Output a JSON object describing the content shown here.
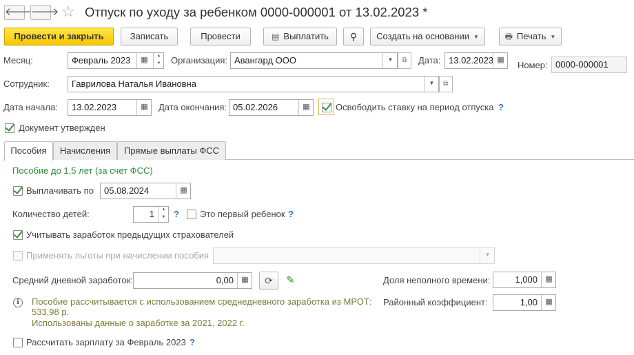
{
  "window": {
    "title": "Отпуск по уходу за ребенком 0000-000001 от 13.02.2023 *",
    "back_glyph": "🡐",
    "forward_glyph": "🡒",
    "star_glyph": "☆"
  },
  "toolbar": {
    "post_close": "Провести и закрыть",
    "save": "Записать",
    "post": "Провести",
    "pay": "Выплатить",
    "create_based": "Создать на основании",
    "print": "Печать"
  },
  "header": {
    "month_label": "Месяц:",
    "month_value": "Февраль 2023",
    "org_label": "Организация:",
    "org_value": "Авангард ООО",
    "date_label": "Дата:",
    "date_value": "13.02.2023",
    "number_label": "Номер:",
    "number_value": "0000-000001",
    "employee_label": "Сотрудник:",
    "employee_value": "Гаврилова Наталья Ивановна",
    "start_label": "Дата начала:",
    "start_value": "13.02.2023",
    "end_label": "Дата окончания:",
    "end_value": "05.02.2026",
    "free_rate_label": "Освободить ставку на период отпуска",
    "free_rate_checked": true,
    "approved_label": "Документ утвержден",
    "approved_checked": true
  },
  "tabs": [
    {
      "label": "Пособия",
      "active": true
    },
    {
      "label": "Начисления",
      "active": false
    },
    {
      "label": "Прямые выплаты ФСС",
      "active": false
    }
  ],
  "benefits": {
    "section_title": "Пособие до 1,5 лет (за счет ФСС)",
    "pay_until_label": "Выплачивать по",
    "pay_until_checked": true,
    "pay_until_value": "05.08.2024",
    "children_label": "Количество детей:",
    "children_value": "1",
    "first_child_label": "Это первый ребенок",
    "first_child_checked": false,
    "prev_insurers_label": "Учитывать заработок предыдущих страхователей",
    "prev_insurers_checked": true,
    "privileges_label": "Применять льготы при начислении пособия",
    "privileges_checked": false,
    "avg_daily_label": "Средний дневной заработок:",
    "avg_daily_value": "0,00",
    "part_time_label": "Доля неполного времени:",
    "part_time_value": "1,000",
    "regional_label": "Районный коэффициент:",
    "regional_value": "1,00",
    "info_line1": "Пособие рассчитывается с использованием среднедневного заработка из МРОТ:",
    "info_line2": "533,98 р.",
    "info_line3": "Использованы данные о заработке за  2021,  2022 г.",
    "calc_salary_label": "Рассчитать зарплату за Февраль 2023",
    "calc_salary_checked": false,
    "help_glyph": "?",
    "info_glyph": "i"
  },
  "colors": {
    "primary_button": "#f7c600",
    "section_title": "#2d8a3a",
    "help_mark": "#2b72d7",
    "check_mark": "#3d8b3d",
    "info_text": "#7d7a3a"
  }
}
